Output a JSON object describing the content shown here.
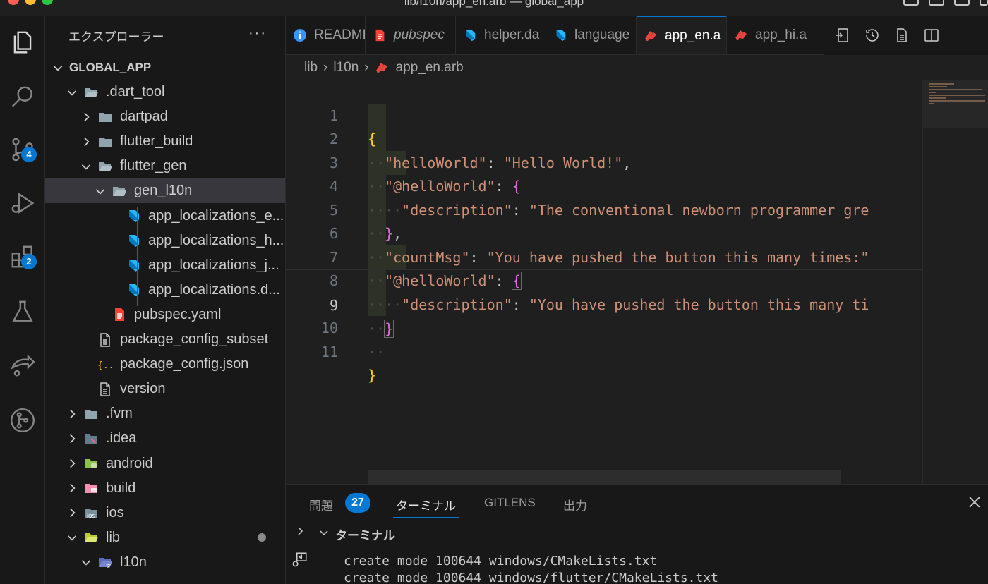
{
  "window": {
    "title": "lib/l10n/app_en.arb — global_app",
    "traffic_colors": [
      "#ff5f57",
      "#febc2e",
      "#28c840"
    ]
  },
  "activity_bar": {
    "items": [
      {
        "name": "explorer",
        "icon": "files-icon"
      },
      {
        "name": "search",
        "icon": "search-icon"
      },
      {
        "name": "source-control",
        "icon": "source-control-icon",
        "badge": "4"
      },
      {
        "name": "run-debug",
        "icon": "run-debug-icon"
      },
      {
        "name": "extensions",
        "icon": "extensions-icon",
        "badge": "2"
      },
      {
        "name": "testing",
        "icon": "flask-icon"
      },
      {
        "name": "remote",
        "icon": "remote-share-icon"
      },
      {
        "name": "gitlens",
        "icon": "git-graph-icon"
      }
    ]
  },
  "sidebar": {
    "title": "エクスプローラー",
    "more": "···",
    "root": "GLOBAL_APP",
    "tree": [
      {
        "label": ".dart_tool",
        "type": "folder-open",
        "expanded": true,
        "depth": 1
      },
      {
        "label": "dartpad",
        "type": "folder",
        "expanded": false,
        "depth": 2
      },
      {
        "label": "flutter_build",
        "type": "folder",
        "expanded": false,
        "depth": 2
      },
      {
        "label": "flutter_gen",
        "type": "folder-open",
        "expanded": true,
        "depth": 2
      },
      {
        "label": "gen_l10n",
        "type": "folder-open",
        "expanded": true,
        "depth": 3,
        "selected": true
      },
      {
        "label": "app_localizations_e...",
        "type": "dart",
        "depth": 4
      },
      {
        "label": "app_localizations_h...",
        "type": "dart",
        "depth": 4
      },
      {
        "label": "app_localizations_j...",
        "type": "dart",
        "depth": 4
      },
      {
        "label": "app_localizations.d...",
        "type": "dart",
        "depth": 4
      },
      {
        "label": "pubspec.yaml",
        "type": "yaml",
        "depth": 3
      },
      {
        "label": "package_config_subset",
        "type": "file",
        "depth": 2
      },
      {
        "label": "package_config.json",
        "type": "json",
        "depth": 2
      },
      {
        "label": "version",
        "type": "file",
        "depth": 2
      },
      {
        "label": ".fvm",
        "type": "folder",
        "expanded": false,
        "depth": 1
      },
      {
        "label": ".idea",
        "type": "folder-idea",
        "expanded": false,
        "depth": 1
      },
      {
        "label": "android",
        "type": "folder-android",
        "expanded": false,
        "depth": 1
      },
      {
        "label": "build",
        "type": "folder-build",
        "expanded": false,
        "depth": 1
      },
      {
        "label": "ios",
        "type": "folder-ios",
        "expanded": false,
        "depth": 1
      },
      {
        "label": "lib",
        "type": "folder-lib",
        "expanded": true,
        "depth": 1,
        "modified": true
      },
      {
        "label": "l10n",
        "type": "folder-l10n",
        "expanded": true,
        "depth": 2
      }
    ]
  },
  "tabs": [
    {
      "label": "README",
      "icon": "info-icon",
      "active": false,
      "italic": false,
      "width": 113
    },
    {
      "label": "pubspec",
      "icon": "yaml-file-icon",
      "active": false,
      "italic": true,
      "width": 128
    },
    {
      "label": "helper.da",
      "icon": "dart-file-icon",
      "active": false,
      "italic": false,
      "width": 128
    },
    {
      "label": "language",
      "icon": "dart-file-icon",
      "active": false,
      "italic": false,
      "width": 128
    },
    {
      "label": "app_en.a",
      "icon": "arb-file-icon",
      "active": true,
      "italic": false,
      "width": 128
    },
    {
      "label": "app_hi.a",
      "icon": "arb-file-icon",
      "active": false,
      "italic": false,
      "width": 128
    },
    {
      "label": "",
      "icon": "arb-file-icon",
      "active": false,
      "italic": false,
      "width": 40
    }
  ],
  "tab_actions": [
    "open-changes-icon",
    "timeline-icon",
    "preview-icon",
    "split-editor-icon"
  ],
  "breadcrumb": [
    "lib",
    "l10n",
    "app_en.arb"
  ],
  "editor": {
    "current_line": 9,
    "lines": [
      {
        "n": "1"
      },
      {
        "n": "2"
      },
      {
        "n": "3"
      },
      {
        "n": "4"
      },
      {
        "n": "5"
      },
      {
        "n": "6"
      },
      {
        "n": "7"
      },
      {
        "n": "8"
      },
      {
        "n": "9"
      },
      {
        "n": "10"
      },
      {
        "n": "11"
      }
    ],
    "tokens": {
      "l2_key": "\"helloWorld\"",
      "l2_val": "\"Hello World!\"",
      "l3_key": "\"@helloWorld\"",
      "l4_key": "\"description\"",
      "l4_val": "\"The conventional newborn programmer gre",
      "l6_key": "\"countMsg\"",
      "l6_val": "\"You have pushed the button this many times:\"",
      "l7_key": "\"@helloWorld\"",
      "l8_key": "\"description\"",
      "l8_val": "\"You have pushed the button this many ti"
    }
  },
  "panel": {
    "tabs": [
      {
        "label": "問題",
        "badge": "27"
      },
      {
        "label": "ターミナル",
        "active": true
      },
      {
        "label": "GITLENS"
      },
      {
        "label": "出力"
      }
    ],
    "section_title": "ターミナル",
    "terminal_lines": [
      "create mode 100644 windows/CMakeLists.txt",
      "create mode 100644 windows/flutter/CMakeLists.txt"
    ]
  }
}
